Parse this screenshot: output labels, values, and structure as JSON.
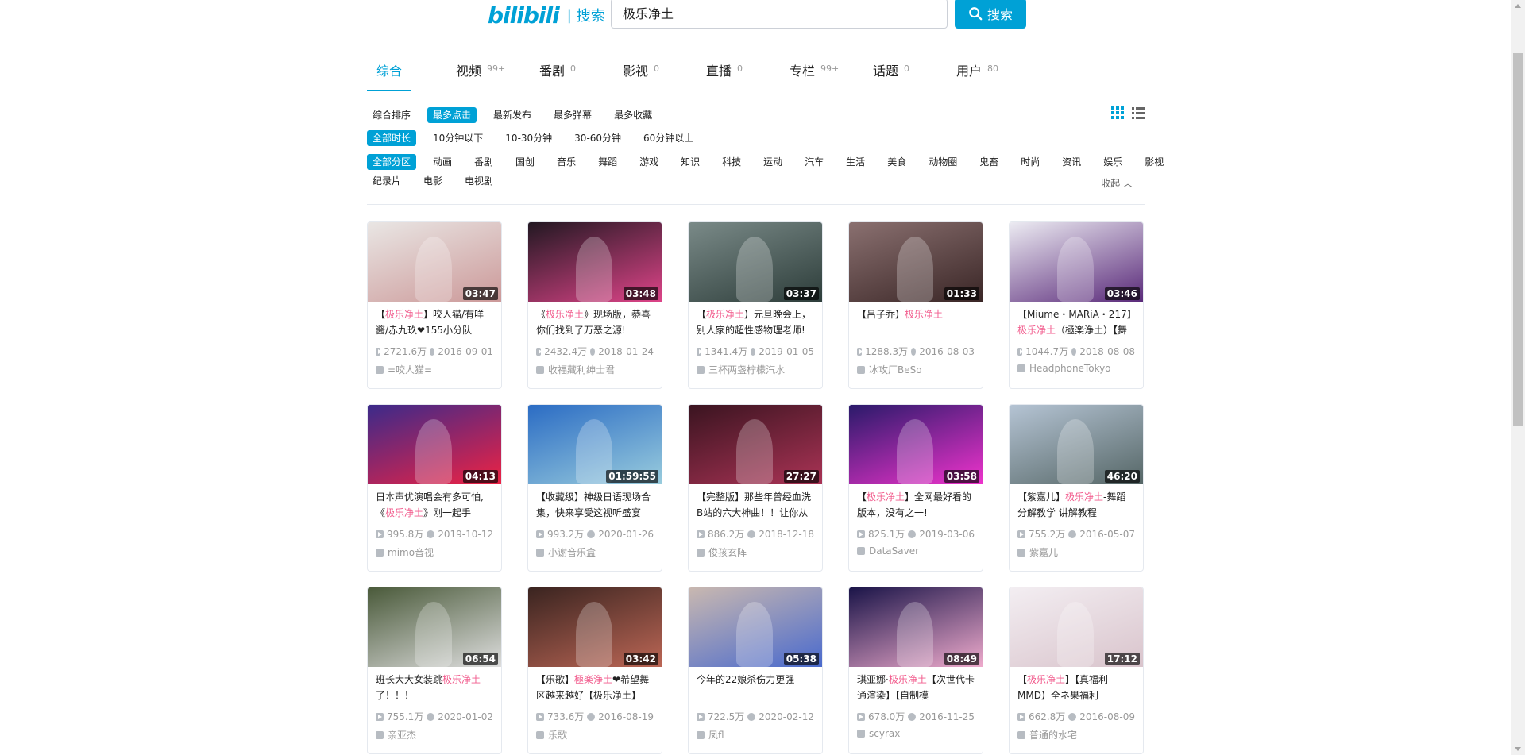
{
  "header": {
    "logo": "bilibili",
    "logo_sep": "|",
    "logo_sub": "搜索",
    "search_value": "极乐净土",
    "search_button": "搜索"
  },
  "tabs": [
    {
      "label": "综合",
      "count": ""
    },
    {
      "label": "视频",
      "count": "99+"
    },
    {
      "label": "番剧",
      "count": "0"
    },
    {
      "label": "影视",
      "count": "0"
    },
    {
      "label": "直播",
      "count": "0"
    },
    {
      "label": "专栏",
      "count": "99+"
    },
    {
      "label": "话题",
      "count": "0"
    },
    {
      "label": "用户",
      "count": "80"
    }
  ],
  "sort": [
    "综合排序",
    "最多点击",
    "最新发布",
    "最多弹幕",
    "最多收藏"
  ],
  "sort_active": 1,
  "duration": [
    "全部时长",
    "10分钟以下",
    "10-30分钟",
    "30-60分钟",
    "60分钟以上"
  ],
  "duration_active": 0,
  "zones_row1": [
    "全部分区",
    "动画",
    "番剧",
    "国创",
    "音乐",
    "舞蹈",
    "游戏",
    "知识",
    "科技",
    "运动",
    "汽车",
    "生活",
    "美食",
    "动物圈",
    "鬼畜",
    "时尚",
    "资讯",
    "娱乐",
    "影视"
  ],
  "zones_row2": [
    "纪录片",
    "电影",
    "电视剧"
  ],
  "zones_active": 0,
  "collapse_label": "收起",
  "videos": [
    {
      "duration": "03:47",
      "title_parts": [
        "【",
        "极乐净土",
        "】咬人猫/有咩酱/赤九玖❤155小分队"
      ],
      "views": "2721.6万",
      "date": "2016-09-01",
      "up": "=咬人猫=",
      "colors": [
        "#e9e6e4",
        "#c99"
      ]
    },
    {
      "duration": "03:48",
      "title_parts": [
        "《",
        "极乐净土",
        "》现场版，恭喜你们找到了万恶之源!"
      ],
      "views": "2432.4万",
      "date": "2018-01-24",
      "up": "收福藏利绅士君",
      "colors": [
        "#221822",
        "#d48"
      ]
    },
    {
      "duration": "03:37",
      "title_parts": [
        "【",
        "极乐净土",
        "】元旦晚会上，别人家的超性感物理老师!"
      ],
      "views": "1341.4万",
      "date": "2019-01-05",
      "up": "三杯两盏柠檬汽水",
      "colors": [
        "#7a8a88",
        "#2d3d3a"
      ]
    },
    {
      "duration": "01:33",
      "title_parts": [
        "【吕子乔】",
        "极乐净土",
        ""
      ],
      "views": "1288.3万",
      "date": "2016-08-03",
      "up": "冰攻厂BeSo",
      "colors": [
        "#8a7070",
        "#3a2626"
      ]
    },
    {
      "duration": "03:46",
      "title_parts": [
        "【Miume・MARiA・217】",
        "极乐净土",
        "（極楽浄土）【舞"
      ],
      "views": "1044.7万",
      "date": "2018-08-08",
      "up": "HeadphoneTokyo",
      "colors": [
        "#ecebf2",
        "#5a2a7a"
      ]
    },
    {
      "duration": "04:13",
      "title_parts": [
        "日本声优演唱会有多可怕,《",
        "极乐净土",
        "》刚一起手"
      ],
      "views": "995.8万",
      "date": "2019-10-12",
      "up": "mimo音视",
      "colors": [
        "#3b2a8a",
        "#e24"
      ]
    },
    {
      "duration": "01:59:55",
      "title_parts": [
        "【收藏级】神级日语现场合集，快来享受这视听盛宴",
        "",
        ""
      ],
      "views": "993.2万",
      "date": "2020-01-26",
      "up": "小谢音乐盒",
      "colors": [
        "#2b6cc4",
        "#9cd"
      ]
    },
    {
      "duration": "27:27",
      "title_parts": [
        "【完整版】那些年曾经血洗B站的六大神曲！！让你从",
        "",
        ""
      ],
      "views": "886.2万",
      "date": "2018-12-18",
      "up": "俊孩玄阵",
      "colors": [
        "#3a1420",
        "#a35"
      ]
    },
    {
      "duration": "03:58",
      "title_parts": [
        "【",
        "极乐净土",
        "】全网最好看的版本，没有之一!"
      ],
      "views": "825.1万",
      "date": "2019-03-06",
      "up": "DataSaver",
      "colors": [
        "#2a1a6a",
        "#e3c"
      ]
    },
    {
      "duration": "46:20",
      "title_parts": [
        "【紫嘉儿】",
        "极乐净土",
        "-舞蹈分解教学 讲解教程"
      ],
      "views": "755.2万",
      "date": "2016-05-07",
      "up": "紫嘉儿",
      "colors": [
        "#b5c4d4",
        "#566"
      ]
    },
    {
      "duration": "06:54",
      "title_parts": [
        "班长大大女装跳",
        "极乐净土",
        "了！！！"
      ],
      "views": "755.1万",
      "date": "2020-01-02",
      "up": "亲亚杰",
      "colors": [
        "#4a5a3a",
        "#ddd"
      ]
    },
    {
      "duration": "03:42",
      "title_parts": [
        "【乐歌】",
        "極楽浄土",
        "❤希望舞区越来越好【极乐净土】"
      ],
      "views": "733.6万",
      "date": "2016-08-19",
      "up": "乐歌",
      "colors": [
        "#3a2420",
        "#b65"
      ]
    },
    {
      "duration": "05:38",
      "title_parts": [
        "今年的22娘杀伤力更强",
        "",
        ""
      ],
      "views": "722.5万",
      "date": "2020-02-12",
      "up": "凤fl",
      "colors": [
        "#c9b8b0",
        "#4a6acd"
      ]
    },
    {
      "duration": "08:49",
      "title_parts": [
        "琪亚娜·",
        "极乐净土",
        "【次世代卡通渲染】【自制模"
      ],
      "views": "678.0万",
      "date": "2016-11-25",
      "up": "scyrax",
      "colors": [
        "#1a1448",
        "#eac"
      ]
    },
    {
      "duration": "17:12",
      "title_parts": [
        "【",
        "极乐净土",
        "】【真福利MMD】全ネ果福利"
      ],
      "views": "662.8万",
      "date": "2016-08-09",
      "up": "普通的水宅",
      "colors": [
        "#f3eef2",
        "#d9c4cc"
      ]
    }
  ]
}
